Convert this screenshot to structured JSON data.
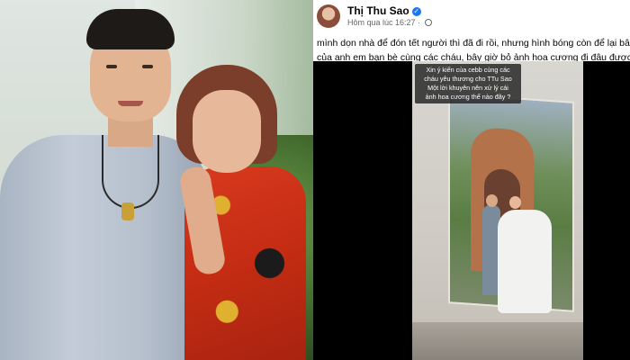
{
  "post": {
    "author_name": "Thị Thu Sao",
    "time": "Hôm qua lúc 16:27 · ",
    "text_line1": "mình dọn nhà để đón tết người thì đã đi rồi, nhưng hình bóng còn để lại bây giờ mình",
    "text_line2": "của anh em bạn bè cùng các cháu, bây giờ bỏ ảnh hoa cương đi đâu được ta"
  },
  "video": {
    "overlay_line1": "Xin ý kiến của cebb cùng các",
    "overlay_line2": "cháu yêu thương cho TTu Sao",
    "overlay_line3": "Một lời khuyên nên xử lý cái",
    "overlay_line4": "ảnh hoa cương thế nào đây ?"
  },
  "colors": {
    "accent": "#1877f2",
    "text": "#050505",
    "muted": "#65676b"
  },
  "icons": [
    "verified-icon",
    "globe-icon"
  ]
}
